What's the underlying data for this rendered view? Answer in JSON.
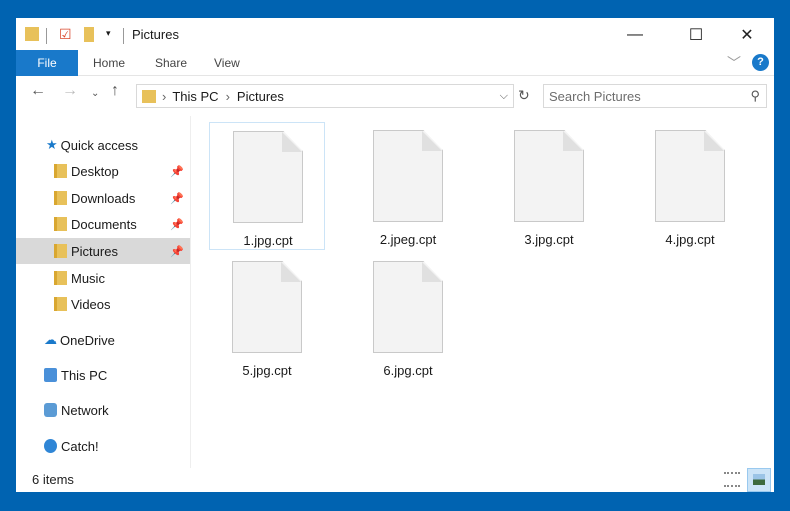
{
  "window": {
    "title": "Pictures"
  },
  "ribbon": {
    "tabs": [
      "File",
      "Home",
      "Share",
      "View"
    ]
  },
  "address": {
    "segments": [
      "This PC",
      "Pictures"
    ]
  },
  "search": {
    "placeholder": "Search Pictures"
  },
  "sidebar": {
    "items": [
      {
        "label": "Quick access",
        "icon": "star-icon",
        "pinned": false
      },
      {
        "label": "Desktop",
        "icon": "desktop-folder-icon",
        "pinned": true
      },
      {
        "label": "Downloads",
        "icon": "downloads-folder-icon",
        "pinned": true
      },
      {
        "label": "Documents",
        "icon": "documents-folder-icon",
        "pinned": true
      },
      {
        "label": "Pictures",
        "icon": "pictures-folder-icon",
        "pinned": true,
        "selected": true
      },
      {
        "label": "Music",
        "icon": "music-folder-icon",
        "pinned": false
      },
      {
        "label": "Videos",
        "icon": "videos-folder-icon",
        "pinned": false
      },
      {
        "label": "OneDrive",
        "icon": "cloud-icon",
        "pinned": false
      },
      {
        "label": "This PC",
        "icon": "computer-icon",
        "pinned": false
      },
      {
        "label": "Network",
        "icon": "network-icon",
        "pinned": false
      },
      {
        "label": "Catch!",
        "icon": "catch-icon",
        "pinned": false
      }
    ]
  },
  "files": [
    "1.jpg.cpt",
    "2.jpeg.cpt",
    "3.jpg.cpt",
    "4.jpg.cpt",
    "5.jpg.cpt",
    "6.jpg.cpt"
  ],
  "status": {
    "count": "6 items"
  },
  "colors": {
    "accent": "#1979ca",
    "border": "#0063b1"
  }
}
